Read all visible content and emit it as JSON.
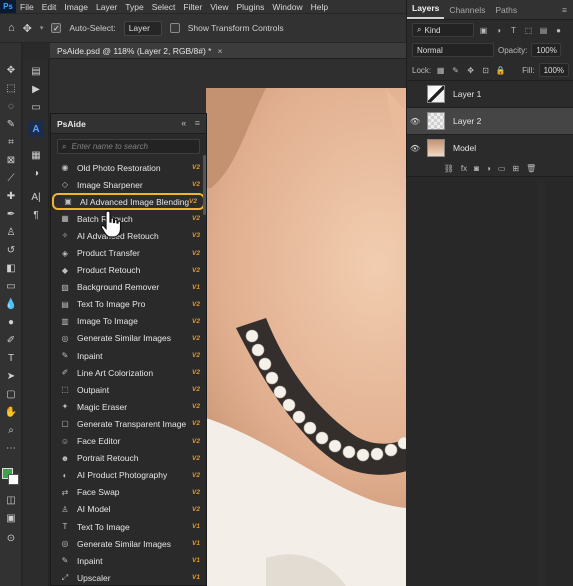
{
  "app": {
    "logo": "Ps"
  },
  "menu": [
    "File",
    "Edit",
    "Image",
    "Layer",
    "Type",
    "Select",
    "Filter",
    "View",
    "Plugins",
    "Window",
    "Help"
  ],
  "options": {
    "auto_select_label": "Auto-Select:",
    "auto_select_checked": true,
    "auto_select_target": "Layer",
    "transform_label": "Show Transform Controls",
    "transform_checked": false
  },
  "document": {
    "tab_title": "PsAide.psd @ 118% (Layer 2, RGB/8#) *",
    "close": "×"
  },
  "psaide": {
    "title": "PsAide",
    "collapse": "«",
    "menu": "≡",
    "search_placeholder": "Enter name to search",
    "items": [
      {
        "label": "Old Photo Restoration",
        "version": "V2",
        "icon": "camera-icon"
      },
      {
        "label": "Image Sharpener",
        "version": "V2",
        "icon": "sharpen-icon"
      },
      {
        "label": "AI Advanced Image Blending",
        "version": "V2",
        "icon": "blend-icon",
        "highlight": true
      },
      {
        "label": "Batch Retouch",
        "version": "V2",
        "icon": "batch-icon"
      },
      {
        "label": "AI Advanced Retouch",
        "version": "V3",
        "icon": "retouch-icon"
      },
      {
        "label": "Product Transfer",
        "version": "V2",
        "icon": "product-icon"
      },
      {
        "label": "Product Retouch",
        "version": "V2",
        "icon": "product-retouch-icon"
      },
      {
        "label": "Background Remover",
        "version": "V1",
        "icon": "background-icon"
      },
      {
        "label": "Text To Image Pro",
        "version": "V2",
        "icon": "text-image-icon"
      },
      {
        "label": "Image To Image",
        "version": "V2",
        "icon": "image-image-icon"
      },
      {
        "label": "Generate Similar Images",
        "version": "V2",
        "icon": "similar-icon"
      },
      {
        "label": "Inpaint",
        "version": "V2",
        "icon": "inpaint-icon"
      },
      {
        "label": "Line Art Colorization",
        "version": "V2",
        "icon": "lineart-icon"
      },
      {
        "label": "Outpaint",
        "version": "V2",
        "icon": "outpaint-icon"
      },
      {
        "label": "Magic Eraser",
        "version": "V2",
        "icon": "eraser-icon"
      },
      {
        "label": "Generate Transparent Image",
        "version": "V2",
        "icon": "transparent-icon"
      },
      {
        "label": "Face Editor",
        "version": "V2",
        "icon": "face-icon"
      },
      {
        "label": "Portrait Retouch",
        "version": "V2",
        "icon": "portrait-icon"
      },
      {
        "label": "AI Product Photography",
        "version": "V2",
        "icon": "photography-icon"
      },
      {
        "label": "Face Swap",
        "version": "V2",
        "icon": "swap-icon"
      },
      {
        "label": "AI Model",
        "version": "V2",
        "icon": "model-icon"
      },
      {
        "label": "Text To Image",
        "version": "V1",
        "icon": "text-icon"
      },
      {
        "label": "Generate Similar Images",
        "version": "V1",
        "icon": "similar-icon"
      },
      {
        "label": "Inpaint",
        "version": "V1",
        "icon": "inpaint-icon"
      },
      {
        "label": "Upscaler",
        "version": "V1",
        "icon": "upscale-icon"
      }
    ]
  },
  "layers_panel": {
    "tabs": [
      "Layers",
      "Channels",
      "Paths"
    ],
    "active_tab": "Layers",
    "filter": "Kind",
    "blend_mode": "Normal",
    "opacity_label": "Opacity:",
    "opacity": "100%",
    "lock_label": "Lock:",
    "fill_label": "Fill:",
    "fill": "100%",
    "layers": [
      {
        "name": "Layer 1",
        "visible": false,
        "selected": false
      },
      {
        "name": "Layer 2",
        "visible": true,
        "selected": true
      },
      {
        "name": "Model",
        "visible": true,
        "selected": false
      }
    ]
  },
  "colors": {
    "accent": "#31a8ff",
    "highlight": "#f0b431",
    "version": "#e29a2b"
  }
}
